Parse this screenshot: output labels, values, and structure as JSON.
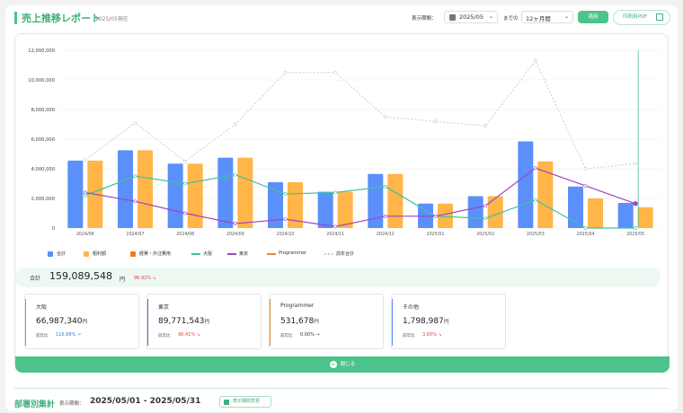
{
  "header": {
    "title": "売上推移レポート",
    "subtitle": "2025/05現在",
    "period_label": "表示期間：",
    "month_value": "2025/05",
    "until_label": "までの",
    "range_value": "12ヶ月間",
    "apply_label": "適用",
    "pdf_label": "印刷用PDF"
  },
  "chart_data": {
    "type": "bar",
    "categories": [
      "2024/06",
      "2024/07",
      "2024/08",
      "2024/09",
      "2024/10",
      "2024/11",
      "2024/12",
      "2025/01",
      "2025/02",
      "2025/03",
      "2025/04",
      "2025/05"
    ],
    "ylim": [
      0,
      12000000
    ],
    "yticks": [
      "0",
      "2,000,000",
      "4,000,000",
      "6,000,000",
      "8,000,000",
      "10,000,000",
      "12,000,000"
    ],
    "grid": true,
    "legend_position": "bottom-left",
    "colors": {
      "total": "#5b8ff9",
      "gross": "#ffb547",
      "ext": "#f27a1a",
      "osaka": "#3ec39b",
      "tokyo": "#9b45c4",
      "programmer": "#d9893b",
      "prev": "#cccccc"
    },
    "series": [
      {
        "name": "合計",
        "key": "total",
        "kind": "bar",
        "values": [
          4550000,
          5250000,
          4350000,
          4750000,
          3100000,
          2450000,
          3650000,
          1650000,
          2150000,
          5850000,
          2800000,
          1700000
        ]
      },
      {
        "name": "粗利額",
        "key": "gross",
        "kind": "bar",
        "values": [
          4550000,
          5250000,
          4350000,
          4750000,
          3100000,
          2450000,
          3650000,
          1650000,
          2150000,
          4500000,
          2000000,
          1400000
        ]
      },
      {
        "name": "経費・外注費用",
        "key": "ext",
        "kind": "bar",
        "values": []
      },
      {
        "name": "大阪",
        "key": "osaka",
        "kind": "line",
        "values": [
          2200000,
          3500000,
          3000000,
          3600000,
          2300000,
          2400000,
          2800000,
          800000,
          650000,
          1900000,
          0,
          0
        ]
      },
      {
        "name": "東京",
        "key": "tokyo",
        "kind": "line",
        "values": [
          2400000,
          1800000,
          1000000,
          300000,
          600000,
          100000,
          800000,
          800000,
          1500000,
          4050000,
          2850000,
          1650000
        ]
      },
      {
        "name": "Programmer",
        "key": "programmer",
        "kind": "line",
        "values": [
          0,
          0,
          0,
          0,
          0,
          0,
          0,
          0,
          0,
          0,
          0,
          0
        ]
      },
      {
        "name": "前年合計",
        "key": "prev",
        "kind": "dashed",
        "values": [
          4600000,
          7100000,
          4500000,
          7000000,
          10500000,
          10500000,
          7500000,
          7200000,
          6900000,
          11300000,
          4000000,
          4350000
        ]
      }
    ]
  },
  "total": {
    "label": "合計",
    "value": "159,089,548",
    "unit": "円",
    "change": "96.92% ↘"
  },
  "regions": [
    {
      "name": "大阪",
      "value": "66,987,340",
      "unit": "円",
      "prev_label": "前年比",
      "pct": "116.88% ↗",
      "color": "#3ec39b",
      "pct_color": "#3b7dd8"
    },
    {
      "name": "東京",
      "value": "89,771,543",
      "unit": "円",
      "prev_label": "前年比",
      "pct": "96.41% ↘",
      "color": "#9b45c4",
      "pct_color": "#e0443b"
    },
    {
      "name": "Programmer",
      "value": "531,678",
      "unit": "円",
      "prev_label": "前年比",
      "pct": "0.00% →",
      "color": "#d9893b",
      "pct_color": "#333333"
    },
    {
      "name": "その他",
      "value": "1,798,987",
      "unit": "円",
      "prev_label": "前年比",
      "pct": "3.65% ↘",
      "color": "#5b8ff9",
      "pct_color": "#e0443b"
    }
  ],
  "close_label": "閉じる",
  "footer": {
    "title": "部署別集計",
    "period_label": "表示期間：",
    "period_value": "2025/05/01 - 2025/05/31",
    "change_label": "表示期間変更"
  }
}
